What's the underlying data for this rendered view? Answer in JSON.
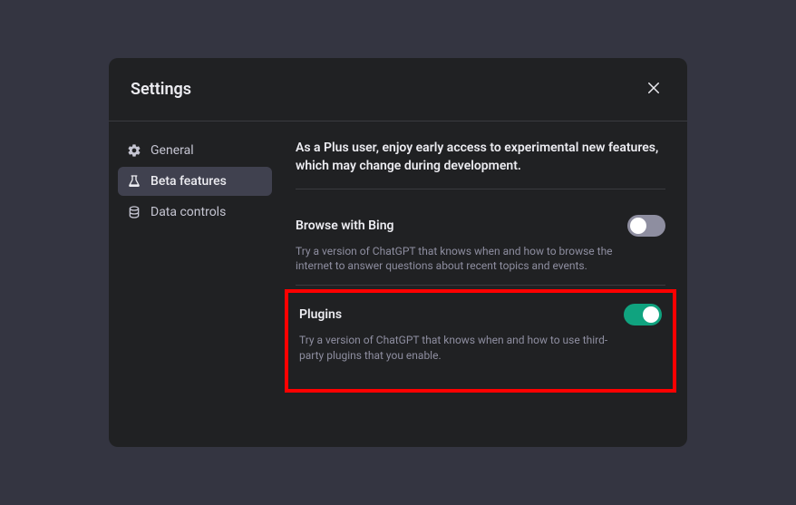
{
  "modal": {
    "title": "Settings"
  },
  "sidebar": {
    "items": [
      {
        "label": "General"
      },
      {
        "label": "Beta features"
      },
      {
        "label": "Data controls"
      }
    ]
  },
  "content": {
    "intro": "As a Plus user, enjoy early access to experimental new features, which may change during development.",
    "features": [
      {
        "title": "Browse with Bing",
        "desc": "Try a version of ChatGPT that knows when and how to browse the internet to answer questions about recent topics and events.",
        "enabled": false
      },
      {
        "title": "Plugins",
        "desc": "Try a version of ChatGPT that knows when and how to use third-party plugins that you enable.",
        "enabled": true
      }
    ]
  }
}
